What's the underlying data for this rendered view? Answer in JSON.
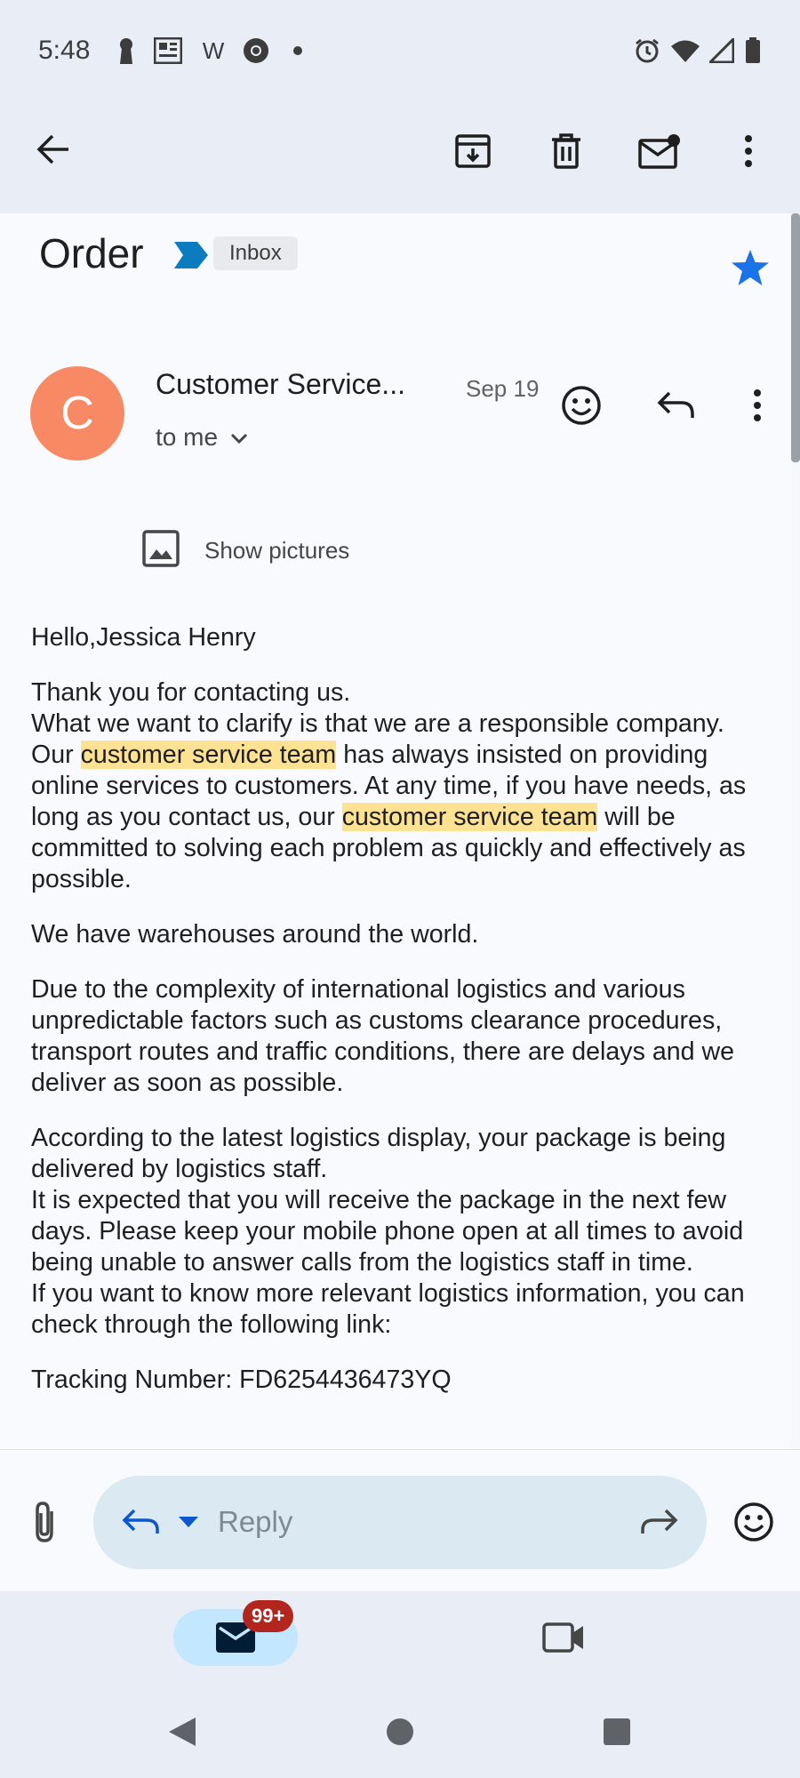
{
  "status_bar": {
    "time": "5:48",
    "left_icons": [
      "keyhole-icon",
      "newspaper-icon",
      "w-app-icon",
      "chrome-icon",
      "dot-icon"
    ],
    "w_letter": "W",
    "right_icons": [
      "alarm-icon",
      "wifi-icon",
      "signal-icon",
      "battery-icon"
    ]
  },
  "app_bar": {
    "icons": [
      "back-arrow-icon",
      "archive-icon",
      "delete-icon",
      "mark-unread-icon",
      "more-vert-icon"
    ]
  },
  "email": {
    "subject": "Order",
    "label_chip": "Inbox",
    "starred": true,
    "sender_initial": "C",
    "sender_name": "Customer Service...",
    "date": "Sep 19",
    "recipient": "to me",
    "show_pictures": "Show pictures",
    "body": {
      "greeting": "Hello,Jessica Henry",
      "p2_line1": "Thank you for contacting us.",
      "p2_line2": "What we want to clarify is that we are a responsible company.",
      "our": "Our ",
      "highlight": "customer service team",
      "p2_mid": " has always insisted on providing online services to customers. At any time, if you have needs, as long as you contact us, our ",
      "p2_end": " will be committed to solving each problem as quickly and effectively as possible.",
      "p3": "We have warehouses around the world.",
      "p4": "Due to the complexity of international logistics and various unpredictable factors such as customs clearance procedures, transport routes and traffic conditions, there are delays and we deliver as soon as possible.",
      "p5_line1": "According to the latest logistics display, your package is being delivered by logistics staff.",
      "p5_line2": "It is expected that you will receive the package in the next few days. Please keep your mobile phone open at all times to avoid being unable to answer calls from the logistics staff in time.",
      "p5_line3": "If you want to know more relevant logistics information, you can check through the following link:",
      "tracking": "Tracking Number: FD6254436473YQ"
    }
  },
  "reply_bar": {
    "placeholder": "Reply"
  },
  "bottom_nav": {
    "mail_badge": "99+",
    "items": [
      "mail-icon",
      "video-icon"
    ]
  },
  "colors": {
    "accent_blue": "#0b57d0",
    "star": "#1a73e8",
    "avatar": "#f78a64",
    "highlight": "#fde293",
    "badge": "#b3261e"
  }
}
